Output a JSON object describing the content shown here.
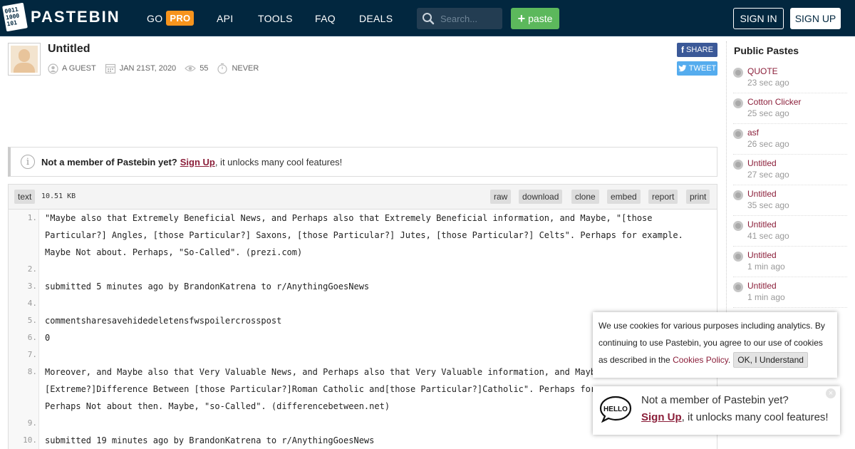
{
  "header": {
    "brand": "PASTEBIN",
    "logo_bits": [
      "0011",
      "1000",
      "101"
    ],
    "nav": {
      "go": "GO",
      "pro": "PRO",
      "api": "API",
      "tools": "TOOLS",
      "faq": "FAQ",
      "deals": "DEALS"
    },
    "search_placeholder": "Search...",
    "paste_label": "paste",
    "sign_in": "SIGN IN",
    "sign_up": "SIGN UP"
  },
  "paste": {
    "title": "Untitled",
    "author": "A GUEST",
    "date": "JAN 21ST, 2020",
    "views": "55",
    "expires": "NEVER",
    "share": "SHARE",
    "tweet": "TWEET"
  },
  "notice": {
    "prefix": "Not a member of Pastebin yet?",
    "link": "Sign Up",
    "suffix": ", it unlocks many cool features!"
  },
  "code": {
    "syntax": "text",
    "size": "10.51 KB",
    "actions": {
      "raw": "raw",
      "download": "download",
      "clone": "clone",
      "embed": "embed",
      "report": "report",
      "print": "print"
    },
    "lines": [
      {
        "n": "1.",
        "text": "\"Maybe also that Extremely Beneficial News, and Perhaps also that Extremely Beneficial information, and Maybe, \"[those Particular?] Angles, [those Particular?] Saxons, [those Particular?] Jutes, [those Particular?] Celts\". Perhaps for example. Maybe Not about. Perhaps, \"So-Called\". (prezi.com)"
      },
      {
        "n": "2.",
        "text": ""
      },
      {
        "n": "3.",
        "text": "submitted 5 minutes ago by BrandonKatrena to r/AnythingGoesNews"
      },
      {
        "n": "4.",
        "text": ""
      },
      {
        "n": "5.",
        "text": "commentsharesavehidedeletensfwspoilercrosspost"
      },
      {
        "n": "6.",
        "text": "0"
      },
      {
        "n": "7.",
        "text": ""
      },
      {
        "n": "8.",
        "text": "Moreover, and Maybe also that Very Valuable News, and Perhaps also that Very Valuable information, and Maybe t\n[Extreme?]Difference Between [those Particular?]Roman Catholic and[those Particular?]Catholic\". Perhaps for ex\nPerhaps Not about then. Maybe, \"so-Called\". (differencebetween.net)"
      },
      {
        "n": "9.",
        "text": ""
      },
      {
        "n": "10.",
        "text": "submitted 19 minutes ago by BrandonKatrena to r/AnythingGoesNews"
      }
    ]
  },
  "sidebar": {
    "title": "Public Pastes",
    "items": [
      {
        "name": "QUOTE",
        "time": "23 sec ago"
      },
      {
        "name": "Cotton Clicker",
        "time": "25 sec ago"
      },
      {
        "name": "asf",
        "time": "26 sec ago"
      },
      {
        "name": "Untitled",
        "time": "27 sec ago"
      },
      {
        "name": "Untitled",
        "time": "35 sec ago"
      },
      {
        "name": "Untitled",
        "time": "41 sec ago"
      },
      {
        "name": "Untitled",
        "time": "1 min ago"
      },
      {
        "name": "Untitled",
        "time": "1 min ago"
      }
    ]
  },
  "cookie": {
    "text": "We use cookies for various purposes including analytics. By continuing to use Pastebin, you agree to our use of cookies as described in the",
    "link": "Cookies Policy",
    "button": "OK, I Understand"
  },
  "hello_popup": {
    "bubble": "HELLO",
    "line1": "Not a member of Pastebin yet?",
    "link": "Sign Up",
    "line2_suffix": ", it unlocks many cool features!",
    "close": "×"
  },
  "colors": {
    "header_bg": "#02273f",
    "pro_badge": "#f7941d",
    "paste_button": "#5cb85c",
    "link": "#8b1f3a",
    "facebook": "#3b5998",
    "twitter": "#55acee"
  }
}
